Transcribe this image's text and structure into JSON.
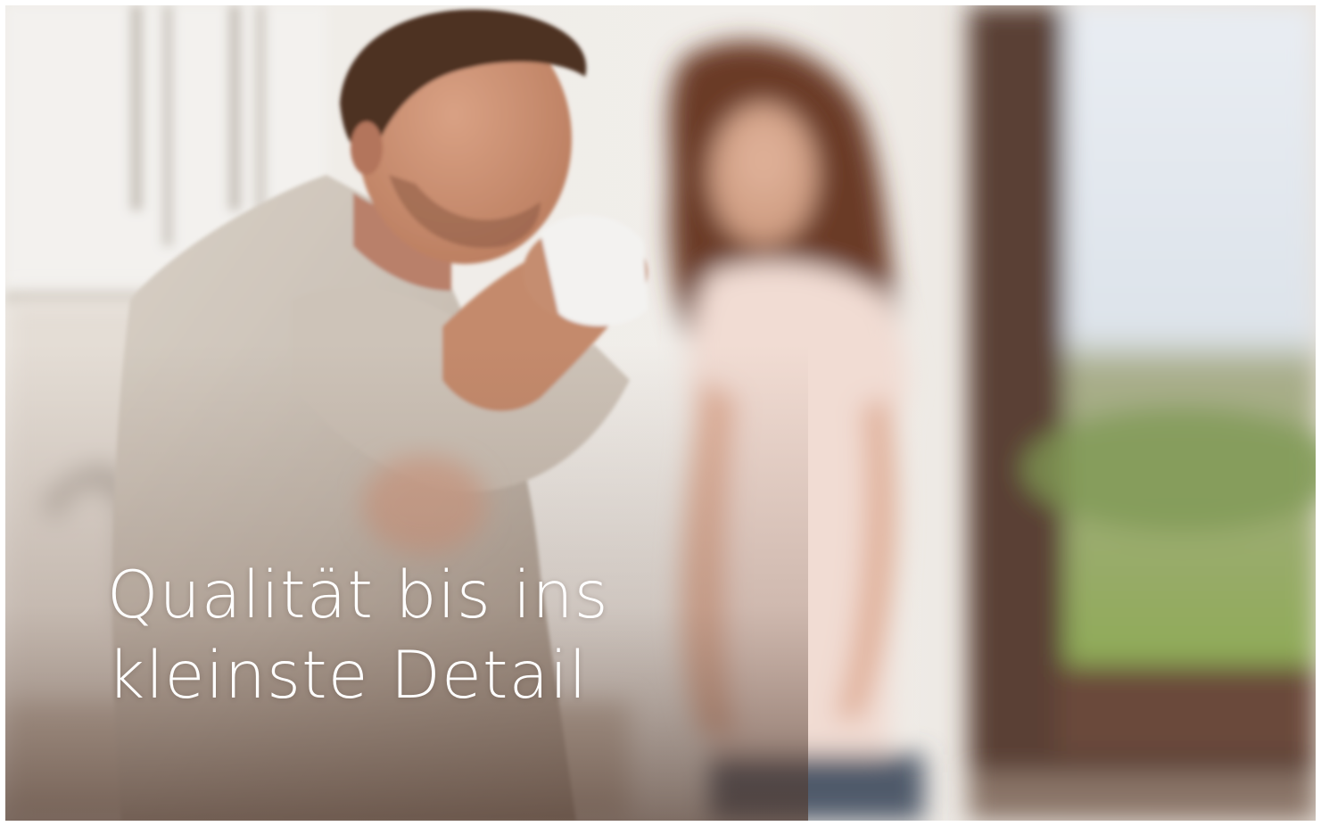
{
  "banner": {
    "headline": {
      "line1": "Qualität bis ins",
      "line2": "kleinste Detail"
    },
    "photo": {
      "subject": "man drinking from a mug with a smiling woman behind him in a bright kitchen, window with green landscape on the right"
    }
  },
  "colors": {
    "headline_text": "#ffffff",
    "window_frame": "#5a3f34",
    "wall": "#ebe6df"
  }
}
